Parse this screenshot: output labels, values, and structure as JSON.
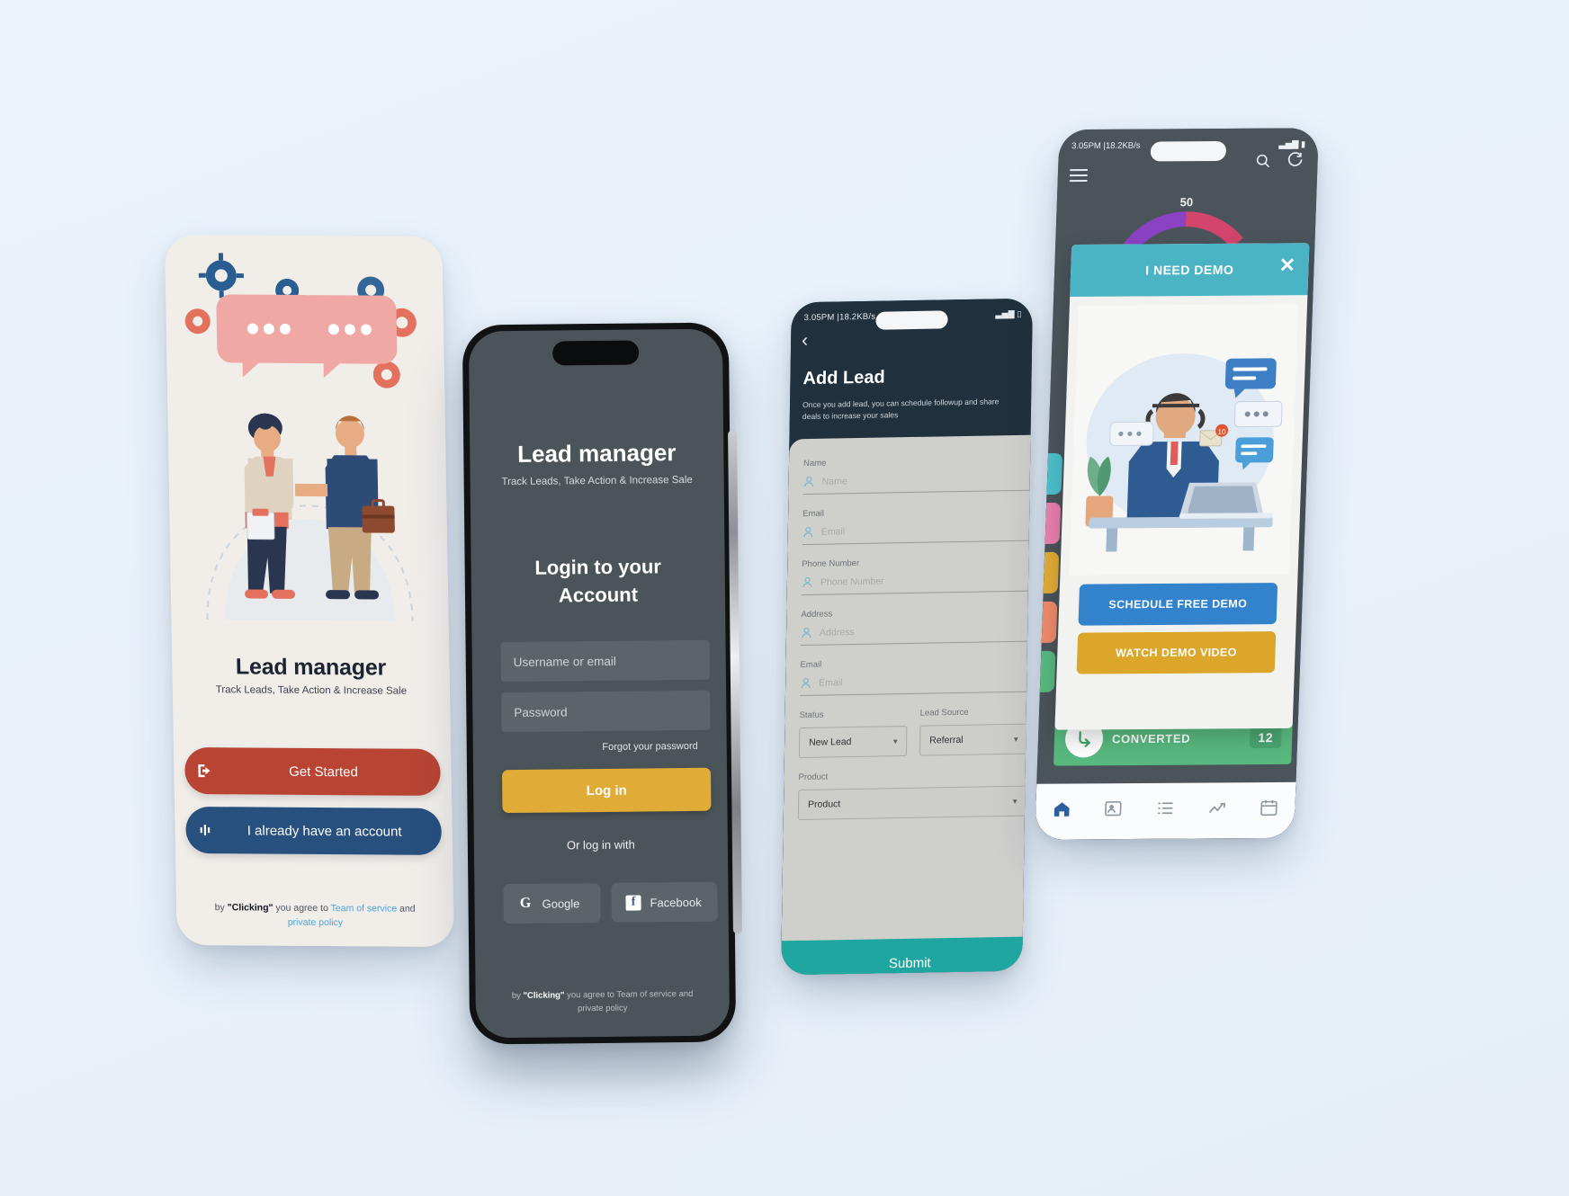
{
  "scene": {
    "background_color": "#e9f2fa",
    "description": "Four mobile app mockup screens for a Lead Manager CRM app"
  },
  "phone1": {
    "name": "onboarding-screen",
    "title": "Lead manager",
    "subtitle": "Track Leads, Take Action & Increase Sale",
    "primary_button": {
      "label": "Get Started",
      "color": "#b94434",
      "icon": "exit-arrow-icon"
    },
    "secondary_button": {
      "label": "I already have an account",
      "color": "#27507f",
      "icon": "equalizer-icon"
    },
    "legal": {
      "prefix": "by ",
      "bold": "\"Clicking\"",
      "middle": " you agree to ",
      "link1": "Team of service",
      "and": " and",
      "link2": "private policy",
      "link_color": "#4aa3d8"
    }
  },
  "phone2": {
    "name": "login-screen",
    "app_title": "Lead manager",
    "app_subtitle": "Track Leads, Take Action & Increase Sale",
    "heading_line1": "Login to your",
    "heading_line2": "Account",
    "username_placeholder": "Username or email",
    "password_placeholder": "Password",
    "forgot_label": "Forgot your password",
    "login_button": "Log in",
    "login_button_color": "#e0ab37",
    "or_label": "Or log in with",
    "google_label": "Google",
    "google_icon": "google-g-icon",
    "facebook_label": "Facebook",
    "facebook_icon": "facebook-f-icon",
    "legal": {
      "prefix": "by ",
      "bold": "\"Clicking\"",
      "middle": " you agree to ",
      "link1": "Team of service",
      "and": " and",
      "link2": "private policy"
    }
  },
  "phone3": {
    "name": "add-lead-screen",
    "status_bar": {
      "time": "3.05PM |18.2KB/s"
    },
    "back_icon": "chevron-left-icon",
    "title": "Add Lead",
    "description": "Once you add lead, you can schedule followup and share deals to increase your sales",
    "fields": [
      {
        "label": "Name",
        "placeholder": "Name",
        "icon": "user-icon"
      },
      {
        "label": "Email",
        "placeholder": "Email",
        "icon": "user-icon"
      },
      {
        "label": "Phone Number",
        "placeholder": "Phone Number",
        "icon": "user-icon"
      },
      {
        "label": "Address",
        "placeholder": "Address",
        "icon": "user-icon"
      },
      {
        "label": "Email",
        "placeholder": "Email",
        "icon": "user-icon"
      }
    ],
    "selects": [
      {
        "label": "Status",
        "value": "New Lead"
      },
      {
        "label": "Lead Source",
        "value": "Referral"
      }
    ],
    "product_select": {
      "label": "Product",
      "value": "Product"
    },
    "submit_label": "Submit",
    "submit_color": "#1fa6a0"
  },
  "phone4": {
    "name": "dashboard-demo-modal-screen",
    "status_bar": {
      "time": "3.05PM |18.2KB/s"
    },
    "menu_icon": "hamburger-menu-icon",
    "search_icon": "search-icon",
    "refresh_icon": "refresh-icon",
    "gauge_value": "50",
    "modal": {
      "title": "I NEED DEMO",
      "close_icon": "close-x-icon",
      "header_color": "#4ab3c4",
      "illustration": "customer-support-agent-illustration",
      "schedule_button": {
        "label": "SCHEDULE FREE DEMO",
        "color": "#3383cc"
      },
      "watch_button": {
        "label": "WATCH DEMO VIDEO",
        "color": "#dba62a"
      }
    },
    "converted_card": {
      "label": "CONVERTED",
      "count": "12",
      "color": "#58b97f",
      "icon": "convert-arrow-icon"
    },
    "tabs": [
      {
        "name": "home",
        "icon": "home-icon",
        "active": true
      },
      {
        "name": "contacts",
        "icon": "contact-card-icon",
        "active": false
      },
      {
        "name": "tasks",
        "icon": "list-icon",
        "active": false
      },
      {
        "name": "reports",
        "icon": "chart-icon",
        "active": false
      },
      {
        "name": "calendar",
        "icon": "calendar-icon",
        "active": false
      }
    ]
  }
}
